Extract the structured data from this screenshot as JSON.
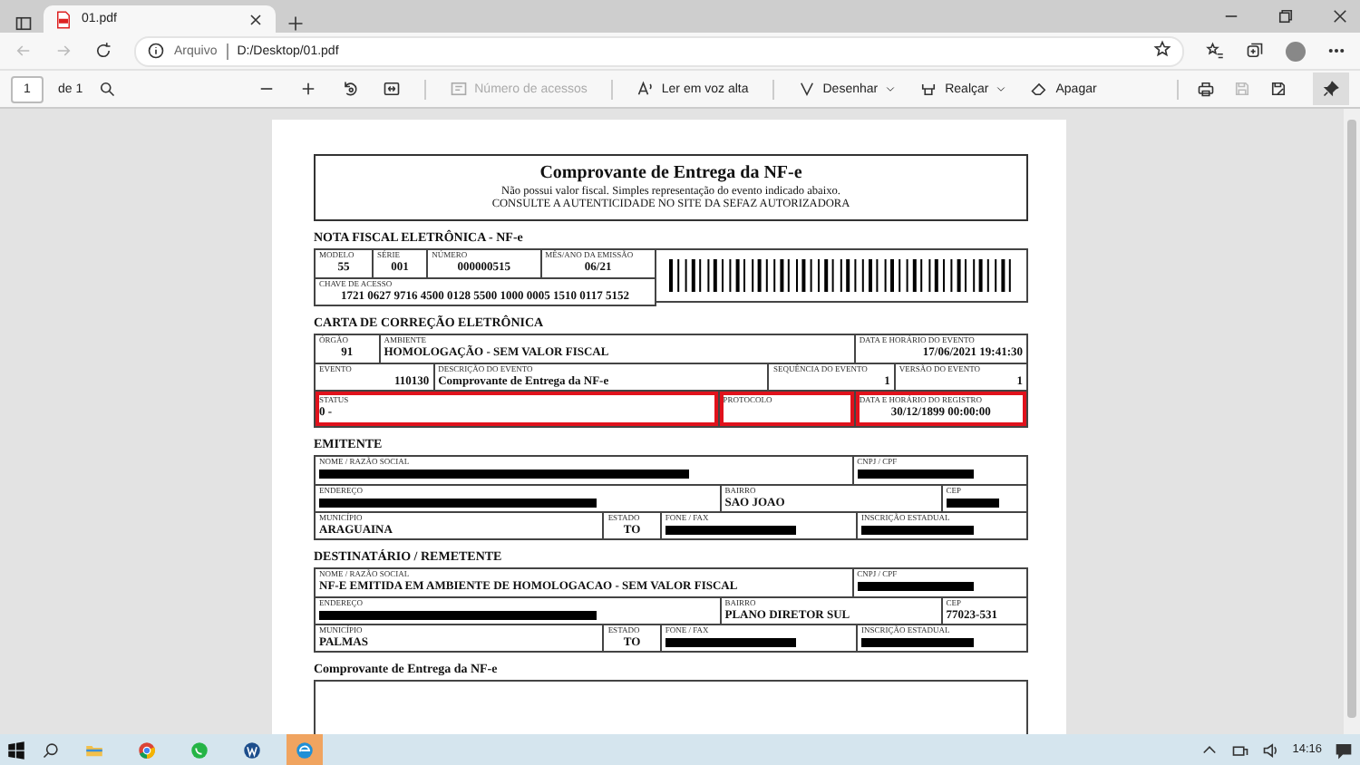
{
  "browser": {
    "tab": {
      "title": "01.pdf"
    },
    "address": {
      "scheme_label": "Arquivo",
      "url": "D:/Desktop/01.pdf"
    }
  },
  "pdf_toolbar": {
    "page": "1",
    "page_count": "de 1",
    "actions": [
      {
        "kind": "access",
        "label": "Número de acessos",
        "disabled": true
      },
      {
        "kind": "read",
        "label": "Ler em voz alta",
        "disabled": false
      },
      {
        "kind": "draw",
        "label": "Desenhar",
        "disabled": false
      },
      {
        "kind": "highlight",
        "label": "Realçar",
        "disabled": false
      },
      {
        "kind": "erase",
        "label": "Apagar",
        "disabled": false
      }
    ]
  },
  "document": {
    "title": "Comprovante de Entrega da NF-e",
    "notes": [
      "Não possui valor fiscal. Simples representação do evento indicado abaixo.",
      "CONSULTE A AUTENTICIDADE NO SITE DA SEFAZ AUTORIZADORA"
    ],
    "sections": [
      {
        "heading": "NOTA FISCAL ELETRÔNICA - NF-e",
        "kind": "with-barcode",
        "lines": [
          [
            {
              "label": "MODELO",
              "value": "55"
            },
            {
              "label": "SÉRIE",
              "value": "001"
            },
            {
              "label": "NÚMERO",
              "value": "000000515"
            },
            {
              "label": "MÊS/ANO DA EMISSÃO",
              "value": "06/21"
            }
          ],
          [
            {
              "label": "CHAVE DE ACESSO",
              "value": "1721 0627 9716 4500 0128 5500 1000 0005 1510 0117 5152"
            }
          ]
        ]
      },
      {
        "heading": "CARTA DE CORREÇÃO ELETRÔNICA",
        "kind": "grid",
        "lines": [
          [
            {
              "label": "ÓRGÃO",
              "value": "91"
            },
            {
              "label": "AMBIENTE",
              "value": "HOMOLOGAÇÃO - SEM VALOR FISCAL"
            },
            {
              "label": "DATA E HORÁRIO DO EVENTO",
              "value": "17/06/2021 19:41:30"
            }
          ],
          [
            {
              "label": "EVENTO",
              "value": "110130"
            },
            {
              "label": "DESCRIÇÃO DO EVENTO",
              "value": "Comprovante de Entrega da NF-e"
            },
            {
              "label": "SEQUÊNCIA DO EVENTO",
              "value": "1"
            },
            {
              "label": "VERSÃO DO EVENTO",
              "value": "1"
            }
          ],
          [
            {
              "label": "STATUS",
              "value": "0 -",
              "highlighted": true
            },
            {
              "label": "PROTOCOLO",
              "highlighted": true
            },
            {
              "label": "DATA E HORÁRIO DO REGISTRO",
              "value": "30/12/1899 00:00:00",
              "highlighted": true
            }
          ]
        ]
      },
      {
        "heading": "EMITENTE",
        "kind": "grid",
        "lines": [
          [
            {
              "label": "NOME / RAZÃO SOCIAL",
              "redacted": true
            },
            {
              "label": "CNPJ / CPF",
              "redacted": true
            }
          ],
          [
            {
              "label": "ENDEREÇO",
              "redacted": true
            },
            {
              "label": "BAIRRO",
              "value": "SAO JOAO",
              "redacted": false
            },
            {
              "label": "CEP",
              "redacted": true
            }
          ],
          [
            {
              "label": "MUNICÍPIO",
              "value": "ARAGUAINA",
              "redacted": false
            },
            {
              "label": "ESTADO",
              "value": "TO",
              "redacted": false
            },
            {
              "label": "FONE / FAX",
              "redacted": true
            },
            {
              "label": "INSCRIÇÃO ESTADUAL",
              "redacted": true
            }
          ]
        ]
      },
      {
        "heading": "DESTINATÁRIO / REMETENTE",
        "kind": "grid",
        "lines": [
          [
            {
              "label": "NOME / RAZÃO SOCIAL",
              "value": "NF-E EMITIDA EM AMBIENTE DE HOMOLOGACAO - SEM VALOR FISCAL",
              "redacted": false
            },
            {
              "label": "CNPJ / CPF",
              "redacted": true
            }
          ],
          [
            {
              "label": "ENDEREÇO",
              "redacted": true
            },
            {
              "label": "BAIRRO",
              "value": "PLANO DIRETOR SUL",
              "redacted": false
            },
            {
              "label": "CEP",
              "value": "77023-531",
              "redacted": false
            }
          ],
          [
            {
              "label": "MUNICÍPIO",
              "value": "PALMAS",
              "redacted": false
            },
            {
              "label": "ESTADO",
              "value": "TO",
              "redacted": false
            },
            {
              "label": "FONE / FAX",
              "redacted": true
            },
            {
              "label": "INSCRIÇÃO ESTADUAL",
              "redacted": true
            }
          ]
        ]
      }
    ],
    "footer_heading": "Comprovante de Entrega da NF-e"
  },
  "taskbar": {
    "time": "14:16"
  }
}
